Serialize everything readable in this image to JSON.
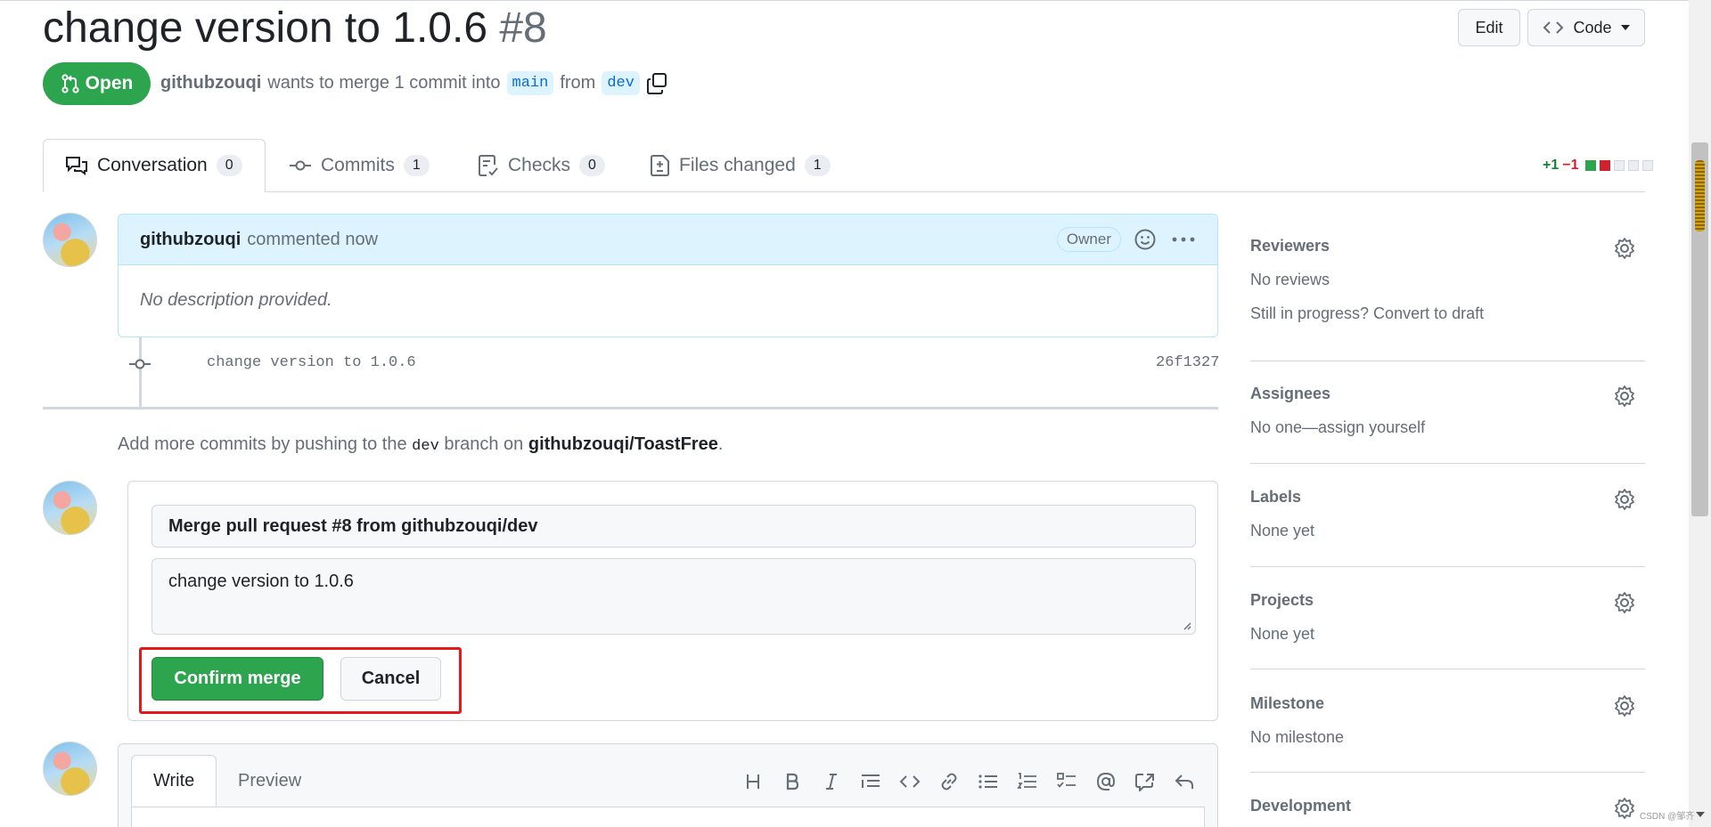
{
  "pr": {
    "title": "change version to 1.0.6",
    "number": "#8",
    "state": "Open",
    "author": "githubzouqi",
    "meta_text": "wants to merge 1 commit into",
    "base_branch": "main",
    "from_text": "from",
    "head_branch": "dev"
  },
  "header": {
    "edit_label": "Edit",
    "code_label": "Code"
  },
  "tabs": [
    {
      "label": "Conversation",
      "count": "0"
    },
    {
      "label": "Commits",
      "count": "1"
    },
    {
      "label": "Checks",
      "count": "0"
    },
    {
      "label": "Files changed",
      "count": "1"
    }
  ],
  "diffstat": {
    "additions": "+1",
    "deletions": "−1"
  },
  "comment": {
    "author": "githubzouqi",
    "time": "commented now",
    "role": "Owner",
    "body": "No description provided."
  },
  "commit": {
    "message": "change version to 1.0.6",
    "sha": "26f1327"
  },
  "push_hint": {
    "prefix": "Add more commits by pushing to the",
    "branch": "dev",
    "middle": "branch on",
    "repo": "githubzouqi/ToastFree",
    "suffix": "."
  },
  "merge": {
    "title_value": "Merge pull request #8 from githubzouqi/dev",
    "message_value": "change version to 1.0.6",
    "confirm_label": "Confirm merge",
    "cancel_label": "Cancel",
    "highlight_color": "#e5191c"
  },
  "editor": {
    "write_tab": "Write",
    "preview_tab": "Preview"
  },
  "sidebar": {
    "reviewers": {
      "title": "Reviewers",
      "value": "No reviews",
      "link": "Still in progress? Convert to draft"
    },
    "assignees": {
      "title": "Assignees",
      "value": "No one—assign yourself"
    },
    "labels": {
      "title": "Labels",
      "value": "None yet"
    },
    "projects": {
      "title": "Projects",
      "value": "None yet"
    },
    "milestone": {
      "title": "Milestone",
      "value": "No milestone"
    },
    "development": {
      "title": "Development"
    }
  },
  "watermark": "CSDN @邹齐",
  "colors": {
    "accent_green": "#2da44e",
    "link_blue": "#0969da",
    "comment_header_bg": "#ddf4ff"
  }
}
